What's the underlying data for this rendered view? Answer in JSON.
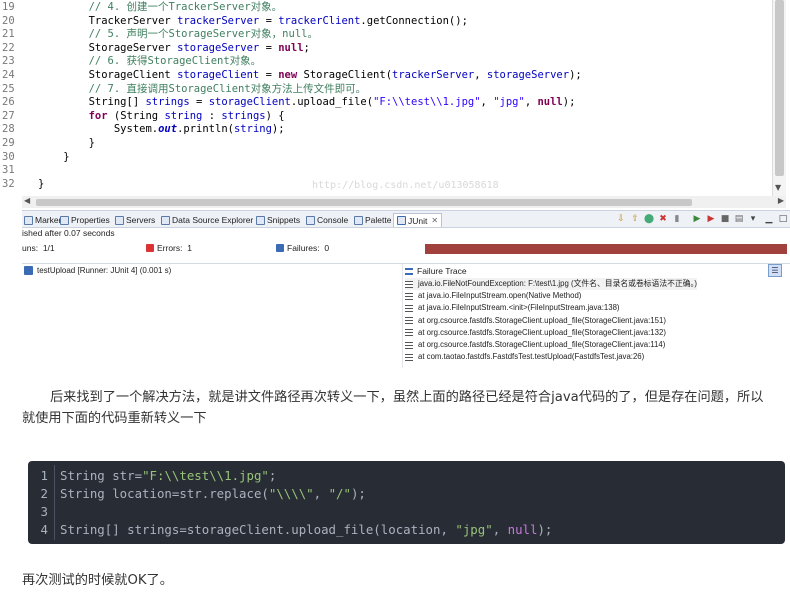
{
  "editor": {
    "lines": [
      {
        "num": "19",
        "segments": [
          {
            "t": "        "
          },
          {
            "t": "// 4. 创建一个TrackerServer对象。",
            "c": "cm"
          }
        ]
      },
      {
        "num": "20",
        "segments": [
          {
            "t": "        TrackerServer "
          },
          {
            "t": "trackerServer",
            "c": "var"
          },
          {
            "t": " = "
          },
          {
            "t": "trackerClient",
            "c": "var"
          },
          {
            "t": ".getConnection();"
          }
        ]
      },
      {
        "num": "21",
        "segments": [
          {
            "t": "        "
          },
          {
            "t": "// 5. 声明一个StorageServer对象，null。",
            "c": "cm"
          }
        ]
      },
      {
        "num": "22",
        "segments": [
          {
            "t": "        StorageServer "
          },
          {
            "t": "storageServer",
            "c": "var"
          },
          {
            "t": " = "
          },
          {
            "t": "null",
            "c": "kw"
          },
          {
            "t": ";"
          }
        ]
      },
      {
        "num": "23",
        "segments": [
          {
            "t": "        "
          },
          {
            "t": "// 6. 获得StorageClient对象。",
            "c": "cm"
          }
        ]
      },
      {
        "num": "24",
        "segments": [
          {
            "t": "        StorageClient "
          },
          {
            "t": "storageClient",
            "c": "var"
          },
          {
            "t": " = "
          },
          {
            "t": "new",
            "c": "kw"
          },
          {
            "t": " StorageClient("
          },
          {
            "t": "trackerServer",
            "c": "var"
          },
          {
            "t": ", "
          },
          {
            "t": "storageServer",
            "c": "var"
          },
          {
            "t": ");"
          }
        ]
      },
      {
        "num": "25",
        "segments": [
          {
            "t": "        "
          },
          {
            "t": "// 7. 直接调用StorageClient对象方法上传文件即可。",
            "c": "cm"
          }
        ]
      },
      {
        "num": "26",
        "segments": [
          {
            "t": "        String[] "
          },
          {
            "t": "strings",
            "c": "var"
          },
          {
            "t": " = "
          },
          {
            "t": "storageClient",
            "c": "var"
          },
          {
            "t": ".upload_file("
          },
          {
            "t": "\"F:\\\\test\\\\1.jpg\"",
            "c": "str"
          },
          {
            "t": ", "
          },
          {
            "t": "\"jpg\"",
            "c": "str"
          },
          {
            "t": ", "
          },
          {
            "t": "null",
            "c": "kw"
          },
          {
            "t": ");"
          }
        ]
      },
      {
        "num": "27",
        "segments": [
          {
            "t": "        "
          },
          {
            "t": "for",
            "c": "kw"
          },
          {
            "t": " (String "
          },
          {
            "t": "string",
            "c": "var"
          },
          {
            "t": " : "
          },
          {
            "t": "strings",
            "c": "var"
          },
          {
            "t": ") {"
          }
        ]
      },
      {
        "num": "28",
        "segments": [
          {
            "t": "            System."
          },
          {
            "t": "out",
            "c": "st"
          },
          {
            "t": ".println("
          },
          {
            "t": "string",
            "c": "var"
          },
          {
            "t": ");"
          }
        ]
      },
      {
        "num": "29",
        "segments": [
          {
            "t": "        }"
          }
        ]
      },
      {
        "num": "30",
        "segments": [
          {
            "t": "    }"
          }
        ]
      },
      {
        "num": "31",
        "segments": [
          {
            "t": ""
          }
        ]
      },
      {
        "num": "32",
        "segments": [
          {
            "t": "}"
          }
        ]
      }
    ],
    "watermark": "http://blog.csdn.net/u013058618"
  },
  "views": {
    "tabs": [
      {
        "label": "Markers",
        "name": "tab-markers"
      },
      {
        "label": "Properties",
        "name": "tab-properties"
      },
      {
        "label": "Servers",
        "name": "tab-servers"
      },
      {
        "label": "Data Source Explorer",
        "name": "tab-data-source-explorer"
      },
      {
        "label": "Snippets",
        "name": "tab-snippets"
      },
      {
        "label": "Console",
        "name": "tab-console"
      },
      {
        "label": "Palette",
        "name": "tab-palette"
      },
      {
        "label": "JUnit",
        "name": "tab-junit",
        "close": "✕"
      }
    ]
  },
  "junit": {
    "status": "ished after 0.07 seconds",
    "runs_label": "uns:",
    "runs_value": "1/1",
    "errors_label": "Errors:",
    "errors_value": "1",
    "failures_label": "Failures:",
    "failures_value": "0",
    "bar_color": "#a0413d",
    "test_item": "testUpload [Runner: JUnit 4] (0.001 s)",
    "trace_title": "Failure Trace",
    "trace": [
      "java.io.FileNotFoundException: F:\\test\\1.jpg (文件名、目录名或卷标语法不正确。)",
      "at java.io.FileInputStream.open(Native Method)",
      "at java.io.FileInputStream.<init>(FileInputStream.java:138)",
      "at org.csource.fastdfs.StorageClient.upload_file(StorageClient.java:151)",
      "at org.csource.fastdfs.StorageClient.upload_file(StorageClient.java:132)",
      "at org.csource.fastdfs.StorageClient.upload_file(StorageClient.java:114)",
      "at com.taotao.fastdfs.FastdfsTest.testUpload(FastdfsTest.java:26)"
    ]
  },
  "article": {
    "para1": "后来找到了一个解决方法，就是讲文件路径再次转义一下，虽然上面的路径已经是符合java代码的了，但是存在问题，所以就使用下面的代码重新转义一下",
    "para2": "再次测试的时候就OK了。"
  },
  "codeblock": {
    "lines": [
      {
        "num": "1",
        "segments": [
          {
            "t": "String str="
          },
          {
            "t": "\"F:\\\\test\\\\1.jpg\"",
            "c": "cs"
          },
          {
            "t": ";"
          }
        ]
      },
      {
        "num": "2",
        "segments": [
          {
            "t": "String location=str.replace("
          },
          {
            "t": "\"\\\\\\\\\"",
            "c": "cs"
          },
          {
            "t": ", "
          },
          {
            "t": "\"/\"",
            "c": "cs"
          },
          {
            "t": ");"
          }
        ]
      },
      {
        "num": "3",
        "segments": [
          {
            "t": ""
          }
        ]
      },
      {
        "num": "4",
        "segments": [
          {
            "t": "String[] strings=storageClient.upload_file(location, "
          },
          {
            "t": "\"jpg\"",
            "c": "cs"
          },
          {
            "t": ", "
          },
          {
            "t": "null",
            "c": "cn"
          },
          {
            "t": ");"
          }
        ]
      }
    ]
  }
}
